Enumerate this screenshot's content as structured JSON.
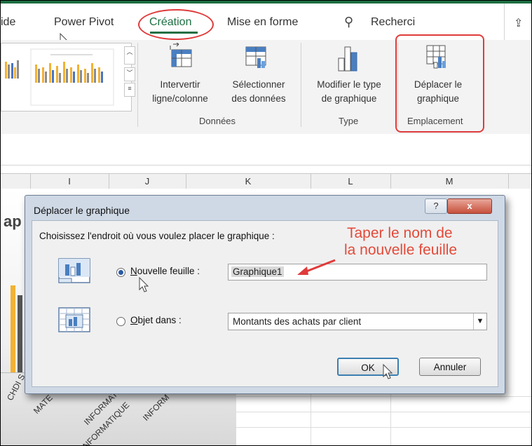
{
  "ribbon": {
    "tabs": [
      "ide",
      "Power Pivot",
      "Création",
      "Mise en forme"
    ],
    "search_label": "Recherci",
    "groups": {
      "donnees": {
        "label": "Données",
        "switch_label_1": "Intervertir",
        "switch_label_2": "ligne/colonne",
        "select_label_1": "Sélectionner",
        "select_label_2": "des données"
      },
      "type": {
        "label": "Type",
        "change_label_1": "Modifier le type",
        "change_label_2": "de graphique"
      },
      "emplacement": {
        "label": "Emplacement",
        "move_label_1": "Déplacer le",
        "move_label_2": "graphique"
      }
    },
    "highlight_color": "#e03b3b"
  },
  "sheet": {
    "columns": [
      "I",
      "J",
      "K",
      "L",
      "M"
    ],
    "chart_title_fragment": "ap",
    "axis_labels": [
      "CHDI S",
      "MATE",
      "INFORMATIQUE",
      "INFORM",
      "INFORMATIQUE"
    ]
  },
  "dialog": {
    "title": "Déplacer le graphique",
    "help_glyph": "?",
    "close_glyph": "x",
    "prompt": "Choisissez l'endroit où vous voulez placer le graphique :",
    "option_new_sheet": {
      "label_underlined": "N",
      "label_rest": "ouvelle feuille :",
      "selected": true,
      "value": "Graphique1"
    },
    "option_object_in": {
      "label_underlined": "O",
      "label_rest": "bjet dans :",
      "selected": false,
      "value": "Montants des achats par client"
    },
    "ok_label": "OK",
    "cancel_label": "Annuler"
  },
  "annotation": {
    "line1": "Taper le nom de",
    "line2": "la nouvelle feuille",
    "color": "#e34a3a"
  }
}
